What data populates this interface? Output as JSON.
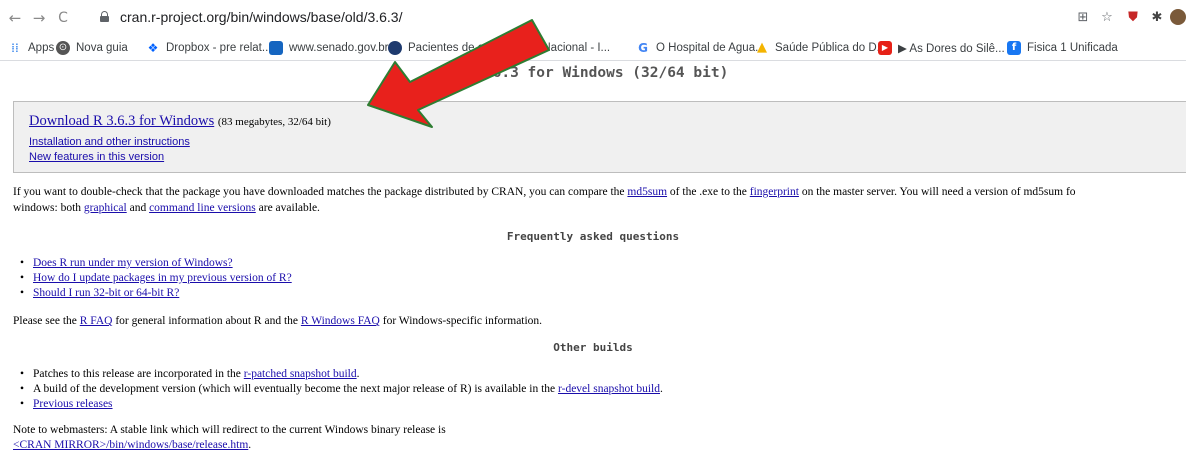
{
  "browser": {
    "url": "cran.r-project.org/bin/windows/base/old/3.6.3/",
    "bookmarks": [
      {
        "label": "Apps",
        "icon": "apps-grid-icon"
      },
      {
        "label": "Nova guia",
        "icon": "chrome-icon"
      },
      {
        "label": "Dropbox - pre relat...",
        "icon": "dropbox-icon"
      },
      {
        "label": "www.senado.gov.br...",
        "icon": "senado-icon"
      },
      {
        "label": "Pacientes de outros ...",
        "icon": "site-icon"
      },
      {
        "label": "rnal Nacional - I...",
        "icon": "site-icon"
      },
      {
        "label": "O Hospital de Agua...",
        "icon": "google-icon"
      },
      {
        "label": "Saúde Pública do D...",
        "icon": "google-drive-icon"
      },
      {
        "label": "▶ As Dores do Silê...",
        "icon": "youtube-icon"
      },
      {
        "label": "Fisica 1 Unificada",
        "icon": "facebook-icon"
      }
    ]
  },
  "page": {
    "title": "R-3.6.3 for Windows (32/64 bit)",
    "download_link": "Download R 3.6.3 for Windows",
    "download_meta": "(83 megabytes, 32/64 bit)",
    "install_link": "Installation and other instructions",
    "features_link": "New features in this version",
    "md5_para": {
      "t1": "If you want to double-check that the package you have downloaded matches the package distributed by CRAN, you can compare the ",
      "md5sum": "md5sum",
      "t2": " of the .exe to the ",
      "fingerprint": "fingerprint",
      "t3": " on the master server. You will need a version of md5sum fo",
      "t4": "windows: both ",
      "graphical": "graphical",
      "t5": " and ",
      "cmdline": "command line versions",
      "t6": " are available."
    },
    "faq_heading": "Frequently asked questions",
    "faq_items": [
      "Does R run under my version of Windows?",
      "How do I update packages in my previous version of R?",
      "Should I run 32-bit or 64-bit R?"
    ],
    "faq_para": {
      "t1": "Please see the ",
      "rfaq": "R FAQ",
      "t2": " for general information about R and the ",
      "wfaq": "R Windows FAQ",
      "t3": " for Windows-specific information."
    },
    "other_heading": "Other builds",
    "other_items": {
      "i1_t1": "Patches to this release are incorporated in the ",
      "i1_link": "r-patched snapshot build",
      "i1_t2": ".",
      "i2_t1": "A build of the development version (which will eventually become the next major release of R) is available in the ",
      "i2_link": "r-devel snapshot build",
      "i2_t2": ".",
      "i3_link": "Previous releases"
    },
    "webmaster": {
      "line1": "Note to webmasters: A stable link which will redirect to the current Windows binary release is",
      "link": "<CRAN MIRROR>/bin/windows/base/release.htm",
      "t2": "."
    }
  },
  "colors": {
    "arrow_fill": "#e8211c",
    "arrow_outline": "#2e7d32",
    "link": "#1a0dab"
  }
}
